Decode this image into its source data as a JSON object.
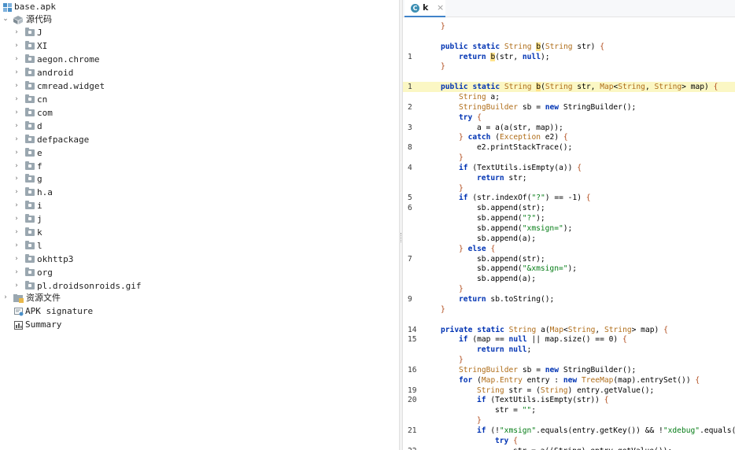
{
  "tree": {
    "root": "base.apk",
    "source_folder": "源代码",
    "packages": [
      "J",
      "XI",
      "aegon.chrome",
      "android",
      "cmread.widget",
      "cn",
      "com",
      "d",
      "defpackage",
      "e",
      "f",
      "g",
      "h.a",
      "i",
      "j",
      "k",
      "l",
      "okhttp3",
      "org",
      "pl.droidsonroids.gif"
    ],
    "resources_folder": "资源文件",
    "apk_signature": "APK signature",
    "summary": "Summary"
  },
  "editor": {
    "tab_label": "k",
    "tab_icon_letter": "C",
    "tab_close": "×",
    "lines": [
      {
        "num": "",
        "indent": 1,
        "tokens": [
          [
            "}",
            "br"
          ]
        ]
      },
      {
        "num": "",
        "indent": 0,
        "tokens": []
      },
      {
        "num": "",
        "indent": 1,
        "tokens": [
          [
            "public",
            "kw"
          ],
          [
            " "
          ],
          [
            "static",
            "kw"
          ],
          [
            " "
          ],
          [
            "String",
            "ty"
          ],
          [
            " "
          ],
          [
            "b",
            "mh"
          ],
          [
            "("
          ],
          [
            "String",
            "ty"
          ],
          [
            " str) "
          ],
          [
            "{",
            "br"
          ]
        ]
      },
      {
        "num": "1",
        "indent": 2,
        "tokens": [
          [
            "return",
            "kw"
          ],
          [
            " "
          ],
          [
            "b",
            "mh"
          ],
          [
            "(str, "
          ],
          [
            "null",
            "kw"
          ],
          [
            ");"
          ]
        ]
      },
      {
        "num": "",
        "indent": 1,
        "tokens": [
          [
            "}",
            "br"
          ]
        ]
      },
      {
        "num": "",
        "indent": 0,
        "tokens": []
      },
      {
        "num": "1",
        "indent": 1,
        "hl": true,
        "tokens": [
          [
            "public",
            "kw"
          ],
          [
            " "
          ],
          [
            "static",
            "kw"
          ],
          [
            " "
          ],
          [
            "String",
            "ty"
          ],
          [
            " "
          ],
          [
            "b",
            "mh"
          ],
          [
            "("
          ],
          [
            "String",
            "ty"
          ],
          [
            " str, "
          ],
          [
            "Map",
            "ty"
          ],
          [
            "<"
          ],
          [
            "String",
            "ty"
          ],
          [
            ", "
          ],
          [
            "String",
            "ty"
          ],
          [
            "> map) "
          ],
          [
            "{",
            "br"
          ]
        ]
      },
      {
        "num": "",
        "indent": 2,
        "tokens": [
          [
            "String",
            "ty"
          ],
          [
            " a;"
          ]
        ]
      },
      {
        "num": "2",
        "indent": 2,
        "tokens": [
          [
            "StringBuilder",
            "ty"
          ],
          [
            " sb = "
          ],
          [
            "new",
            "kw"
          ],
          [
            " StringBuilder();"
          ]
        ]
      },
      {
        "num": "",
        "indent": 2,
        "tokens": [
          [
            "try",
            "kw"
          ],
          [
            " "
          ],
          [
            "{",
            "br"
          ]
        ]
      },
      {
        "num": "3",
        "indent": 3,
        "tokens": [
          [
            "a = a(a(str, map));"
          ]
        ]
      },
      {
        "num": "",
        "indent": 2,
        "tokens": [
          [
            "}",
            "br"
          ],
          [
            " "
          ],
          [
            "catch",
            "kw"
          ],
          [
            " ("
          ],
          [
            "Exception",
            "ty"
          ],
          [
            " e2) "
          ],
          [
            "{",
            "br"
          ]
        ]
      },
      {
        "num": "8",
        "indent": 3,
        "tokens": [
          [
            "e2.printStackTrace();"
          ]
        ]
      },
      {
        "num": "",
        "indent": 2,
        "tokens": [
          [
            "}",
            "br"
          ]
        ]
      },
      {
        "num": "4",
        "indent": 2,
        "tokens": [
          [
            "if",
            "kw"
          ],
          [
            " (TextUtils.isEmpty(a)) "
          ],
          [
            "{",
            "br"
          ]
        ]
      },
      {
        "num": "",
        "indent": 3,
        "tokens": [
          [
            "return",
            "kw"
          ],
          [
            " str;"
          ]
        ]
      },
      {
        "num": "",
        "indent": 2,
        "tokens": [
          [
            "}",
            "br"
          ]
        ]
      },
      {
        "num": "5",
        "indent": 2,
        "tokens": [
          [
            "if",
            "kw"
          ],
          [
            " (str.indexOf("
          ],
          [
            "\"?\"",
            "str"
          ],
          [
            ") == -1) "
          ],
          [
            "{",
            "br"
          ]
        ]
      },
      {
        "num": "6",
        "indent": 3,
        "tokens": [
          [
            "sb.append(str);"
          ]
        ]
      },
      {
        "num": "",
        "indent": 3,
        "tokens": [
          [
            "sb.append("
          ],
          [
            "\"?\"",
            "str"
          ],
          [
            ");"
          ]
        ]
      },
      {
        "num": "",
        "indent": 3,
        "tokens": [
          [
            "sb.append("
          ],
          [
            "\"xmsign=\"",
            "str"
          ],
          [
            ");"
          ]
        ]
      },
      {
        "num": "",
        "indent": 3,
        "tokens": [
          [
            "sb.append(a);"
          ]
        ]
      },
      {
        "num": "",
        "indent": 2,
        "tokens": [
          [
            "}",
            "br"
          ],
          [
            " "
          ],
          [
            "else",
            "kw"
          ],
          [
            " "
          ],
          [
            "{",
            "br"
          ]
        ]
      },
      {
        "num": "7",
        "indent": 3,
        "tokens": [
          [
            "sb.append(str);"
          ]
        ]
      },
      {
        "num": "",
        "indent": 3,
        "tokens": [
          [
            "sb.append("
          ],
          [
            "\"&xmsign=\"",
            "str"
          ],
          [
            ");"
          ]
        ]
      },
      {
        "num": "",
        "indent": 3,
        "tokens": [
          [
            "sb.append(a);"
          ]
        ]
      },
      {
        "num": "",
        "indent": 2,
        "tokens": [
          [
            "}",
            "br"
          ]
        ]
      },
      {
        "num": "9",
        "indent": 2,
        "tokens": [
          [
            "return",
            "kw"
          ],
          [
            " sb.toString();"
          ]
        ]
      },
      {
        "num": "",
        "indent": 1,
        "tokens": [
          [
            "}",
            "br"
          ]
        ]
      },
      {
        "num": "",
        "indent": 0,
        "tokens": []
      },
      {
        "num": "14",
        "indent": 1,
        "tokens": [
          [
            "private",
            "kw"
          ],
          [
            " "
          ],
          [
            "static",
            "kw"
          ],
          [
            " "
          ],
          [
            "String",
            "ty"
          ],
          [
            " a("
          ],
          [
            "Map",
            "ty"
          ],
          [
            "<"
          ],
          [
            "String",
            "ty"
          ],
          [
            ", "
          ],
          [
            "String",
            "ty"
          ],
          [
            "> map) "
          ],
          [
            "{",
            "br"
          ]
        ]
      },
      {
        "num": "15",
        "indent": 2,
        "tokens": [
          [
            "if",
            "kw"
          ],
          [
            " (map == "
          ],
          [
            "null",
            "kw"
          ],
          [
            " || map.size() == 0) "
          ],
          [
            "{",
            "br"
          ]
        ]
      },
      {
        "num": "",
        "indent": 3,
        "tokens": [
          [
            "return",
            "kw"
          ],
          [
            " "
          ],
          [
            "null",
            "kw"
          ],
          [
            ";"
          ]
        ]
      },
      {
        "num": "",
        "indent": 2,
        "tokens": [
          [
            "}",
            "br"
          ]
        ]
      },
      {
        "num": "16",
        "indent": 2,
        "tokens": [
          [
            "StringBuilder",
            "ty"
          ],
          [
            " sb = "
          ],
          [
            "new",
            "kw"
          ],
          [
            " StringBuilder();"
          ]
        ]
      },
      {
        "num": "",
        "indent": 2,
        "tokens": [
          [
            "for",
            "kw"
          ],
          [
            " ("
          ],
          [
            "Map.Entry",
            "ty"
          ],
          [
            " entry : "
          ],
          [
            "new",
            "kw"
          ],
          [
            " "
          ],
          [
            "TreeMap",
            "ty"
          ],
          [
            "(map).entrySet()) "
          ],
          [
            "{",
            "br"
          ]
        ]
      },
      {
        "num": "19",
        "indent": 3,
        "tokens": [
          [
            "String",
            "ty"
          ],
          [
            " str = ("
          ],
          [
            "String",
            "ty"
          ],
          [
            ") entry.getValue();"
          ]
        ]
      },
      {
        "num": "20",
        "indent": 3,
        "tokens": [
          [
            "if",
            "kw"
          ],
          [
            " (TextUtils.isEmpty(str)) "
          ],
          [
            "{",
            "br"
          ]
        ]
      },
      {
        "num": "",
        "indent": 4,
        "tokens": [
          [
            "str = "
          ],
          [
            "\"\"",
            "str"
          ],
          [
            ";"
          ]
        ]
      },
      {
        "num": "",
        "indent": 3,
        "tokens": [
          [
            "}",
            "br"
          ]
        ]
      },
      {
        "num": "21",
        "indent": 3,
        "tokens": [
          [
            "if",
            "kw"
          ],
          [
            " (!"
          ],
          [
            "\"xmsign\"",
            "str"
          ],
          [
            ".equals(entry.getKey()) && !"
          ],
          [
            "\"xdebug\"",
            "str"
          ],
          [
            ".equals(entry.getKey()))"
          ]
        ]
      },
      {
        "num": "",
        "indent": 4,
        "tokens": [
          [
            "try",
            "kw"
          ],
          [
            " "
          ],
          [
            "{",
            "br"
          ]
        ]
      },
      {
        "num": "22",
        "indent": 5,
        "tokens": [
          [
            "str = a((String) entry.getValue());"
          ]
        ]
      }
    ]
  },
  "colors": {
    "keyword": "#0033b3",
    "type": "#b06e1a",
    "string": "#067d17",
    "highlight_line": "#fbf7c4",
    "method_highlight": "#ffe38a",
    "tab_underline": "#4083c9"
  }
}
